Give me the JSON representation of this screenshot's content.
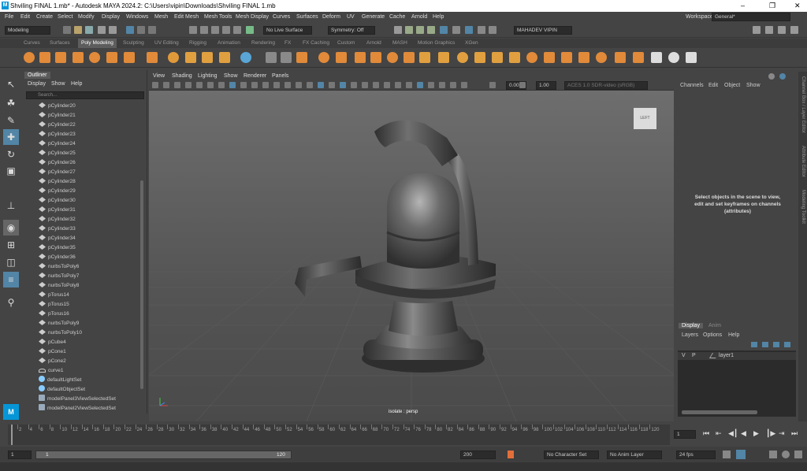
{
  "window": {
    "title": "Shviling FINAL 1.mb* - Autodesk MAYA 2024.2: C:\\Users\\vipin\\Downloads\\Shviling FINAL 1.mb",
    "logo": "M",
    "minimize": "–",
    "maximize": "❐",
    "close": "✕"
  },
  "menubar": {
    "items": [
      "File",
      "Edit",
      "Create",
      "Select",
      "Modify",
      "Display",
      "Windows",
      "Mesh",
      "Edit Mesh",
      "Mesh Tools",
      "Mesh Display",
      "Curves",
      "Surfaces",
      "Deform",
      "UV",
      "Generate",
      "Cache",
      "Arnold",
      "Help"
    ],
    "workspace_label": "Workspace:",
    "workspace_value": "General*"
  },
  "statusline": {
    "mode": "Modeling",
    "live_surface": "No Live Surface",
    "symmetry": "Symmetry: Off",
    "user": "MAHADEV VIPIN"
  },
  "shelf_tabs": [
    "Curves",
    "Surfaces",
    "Poly Modeling",
    "Sculpting",
    "UV Editing",
    "Rigging",
    "Animation",
    "Rendering",
    "FX",
    "FX Caching",
    "Custom",
    "Arnold",
    "MASH",
    "Motion Graphics",
    "XGen"
  ],
  "shelf_active": "Poly Modeling",
  "outliner": {
    "title": "Outliner",
    "menu": [
      "Display",
      "Show",
      "Help"
    ],
    "search_placeholder": "Search...",
    "items": [
      {
        "label": "pCylinder20",
        "type": "mesh"
      },
      {
        "label": "pCylinder21",
        "type": "mesh"
      },
      {
        "label": "pCylinder22",
        "type": "mesh"
      },
      {
        "label": "pCylinder23",
        "type": "mesh"
      },
      {
        "label": "pCylinder24",
        "type": "mesh"
      },
      {
        "label": "pCylinder25",
        "type": "mesh"
      },
      {
        "label": "pCylinder26",
        "type": "mesh"
      },
      {
        "label": "pCylinder27",
        "type": "mesh"
      },
      {
        "label": "pCylinder28",
        "type": "mesh"
      },
      {
        "label": "pCylinder29",
        "type": "mesh"
      },
      {
        "label": "pCylinder30",
        "type": "mesh"
      },
      {
        "label": "pCylinder31",
        "type": "mesh"
      },
      {
        "label": "pCylinder32",
        "type": "mesh"
      },
      {
        "label": "pCylinder33",
        "type": "mesh"
      },
      {
        "label": "pCylinder34",
        "type": "mesh"
      },
      {
        "label": "pCylinder35",
        "type": "mesh"
      },
      {
        "label": "pCylinder36",
        "type": "mesh"
      },
      {
        "label": "nurbsToPoly6",
        "type": "mesh"
      },
      {
        "label": "nurbsToPoly7",
        "type": "mesh"
      },
      {
        "label": "nurbsToPoly8",
        "type": "mesh"
      },
      {
        "label": "pTorus14",
        "type": "mesh"
      },
      {
        "label": "pTorus15",
        "type": "mesh"
      },
      {
        "label": "pTorus16",
        "type": "mesh"
      },
      {
        "label": "nurbsToPoly9",
        "type": "mesh"
      },
      {
        "label": "nurbsToPoly10",
        "type": "mesh"
      },
      {
        "label": "pCube4",
        "type": "mesh"
      },
      {
        "label": "pCone1",
        "type": "mesh"
      },
      {
        "label": "pCone2",
        "type": "mesh"
      },
      {
        "label": "curve1",
        "type": "curve"
      },
      {
        "label": "defaultLightSet",
        "type": "set"
      },
      {
        "label": "defaultObjectSet",
        "type": "set"
      },
      {
        "label": "modelPanel3ViewSelectedSet",
        "type": "mset"
      },
      {
        "label": "modelPanel2ViewSelectedSet",
        "type": "mset"
      }
    ]
  },
  "viewport": {
    "menu": [
      "View",
      "Shading",
      "Lighting",
      "Show",
      "Renderer",
      "Panels"
    ],
    "field1": "0.00",
    "field2": "1.00",
    "colorspace": "ACES 1.0 SDR-video (sRGB)",
    "cube_label": "LEFT",
    "camera_label": "isolate : persp"
  },
  "channel_box": {
    "menu": [
      "Channels",
      "Edit",
      "Object",
      "Show"
    ],
    "message": "Select objects in the scene to view, edit and set keyframes on channels (attributes)"
  },
  "side_tabs": [
    "Channel Box / Layer Editor",
    "Attribute Editor",
    "Modeling Toolkit"
  ],
  "layers": {
    "tabs": [
      "Display",
      "Anim"
    ],
    "menu": [
      "Layers",
      "Options",
      "Help"
    ],
    "layer_v": "V",
    "layer_p": "P",
    "layer_name": "layer1"
  },
  "timeline": {
    "ticks": [
      "2",
      "4",
      "6",
      "8",
      "10",
      "12",
      "14",
      "16",
      "18",
      "20",
      "22",
      "24",
      "26",
      "28",
      "30",
      "32",
      "34",
      "36",
      "38",
      "40",
      "42",
      "44",
      "46",
      "48",
      "50",
      "52",
      "54",
      "56",
      "58",
      "60",
      "62",
      "64",
      "66",
      "68",
      "70",
      "72",
      "74",
      "76",
      "78",
      "80",
      "82",
      "84",
      "86",
      "88",
      "90",
      "92",
      "94",
      "96",
      "98",
      "100",
      "102",
      "104",
      "106",
      "108",
      "110",
      "112",
      "114",
      "116",
      "118",
      "120"
    ],
    "current_frame": "1"
  },
  "range": {
    "start": "1",
    "inner_start": "1",
    "inner_end": "120",
    "end": "200",
    "character_set": "No Character Set",
    "anim_layer": "No Anim Layer",
    "fps": "24 fps"
  },
  "colors": {
    "accent": "#5285a6",
    "active_tab": "#5d5d5d",
    "viewport_top": "#6e6e6e"
  }
}
